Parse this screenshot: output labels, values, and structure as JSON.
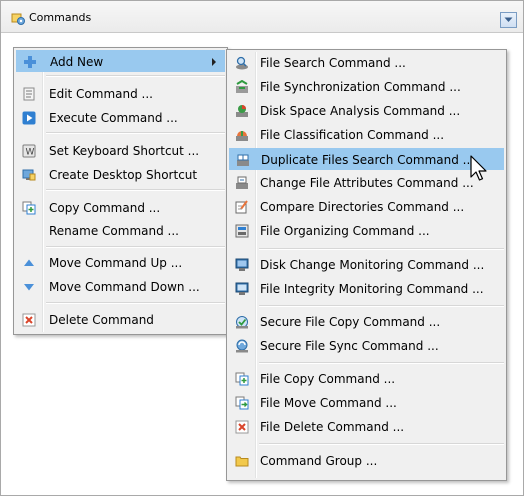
{
  "window": {
    "title": "Commands"
  },
  "left_menu": {
    "items": [
      {
        "label": "Add New",
        "icon": "plus-icon",
        "highlighted": true,
        "submenu": true
      },
      {
        "label": "Edit Command ...",
        "icon": "edit-icon"
      },
      {
        "label": "Execute Command ...",
        "icon": "play-icon"
      },
      {
        "label": "Set Keyboard Shortcut ...",
        "icon": "keyboard-icon"
      },
      {
        "label": "Create Desktop Shortcut",
        "icon": "shortcut-icon"
      },
      {
        "label": "Copy Command ...",
        "icon": "copy-icon"
      },
      {
        "label": "Rename Command ...",
        "icon": ""
      },
      {
        "label": "Move Command Up ...",
        "icon": "up-triangle-icon"
      },
      {
        "label": "Move Command Down ...",
        "icon": "down-triangle-icon"
      },
      {
        "label": "Delete Command",
        "icon": "delete-icon"
      }
    ]
  },
  "right_menu": {
    "items": [
      {
        "label": "File Search Command ...",
        "icon": "file-search-icon"
      },
      {
        "label": "File Synchronization Command ...",
        "icon": "file-sync-icon"
      },
      {
        "label": "Disk Space Analysis Command ...",
        "icon": "disk-space-icon"
      },
      {
        "label": "File Classification Command ...",
        "icon": "classification-icon"
      },
      {
        "label": "Duplicate Files Search Command ...",
        "icon": "duplicate-icon",
        "highlighted": true
      },
      {
        "label": "Change File Attributes Command ...",
        "icon": "attributes-icon"
      },
      {
        "label": "Compare Directories Command ...",
        "icon": "compare-icon"
      },
      {
        "label": "File Organizing Command ...",
        "icon": "organizing-icon"
      },
      {
        "label": "Disk Change Monitoring Command ...",
        "icon": "monitor-icon"
      },
      {
        "label": "File Integrity Monitoring Command ...",
        "icon": "integrity-icon"
      },
      {
        "label": "Secure File Copy Command ...",
        "icon": "secure-copy-icon"
      },
      {
        "label": "Secure File Sync Command ...",
        "icon": "secure-sync-icon"
      },
      {
        "label": "File Copy Command ...",
        "icon": "file-copy-icon"
      },
      {
        "label": "File Move Command ...",
        "icon": "file-move-icon"
      },
      {
        "label": "File Delete Command ...",
        "icon": "file-delete-icon"
      },
      {
        "label": "Command Group ...",
        "icon": "folder-icon"
      }
    ]
  },
  "colors": {
    "highlight": "#99c9ef",
    "accent_blue": "#2f7fd1",
    "delete_red": "#d9452b",
    "folder_yellow": "#f2c94c"
  }
}
